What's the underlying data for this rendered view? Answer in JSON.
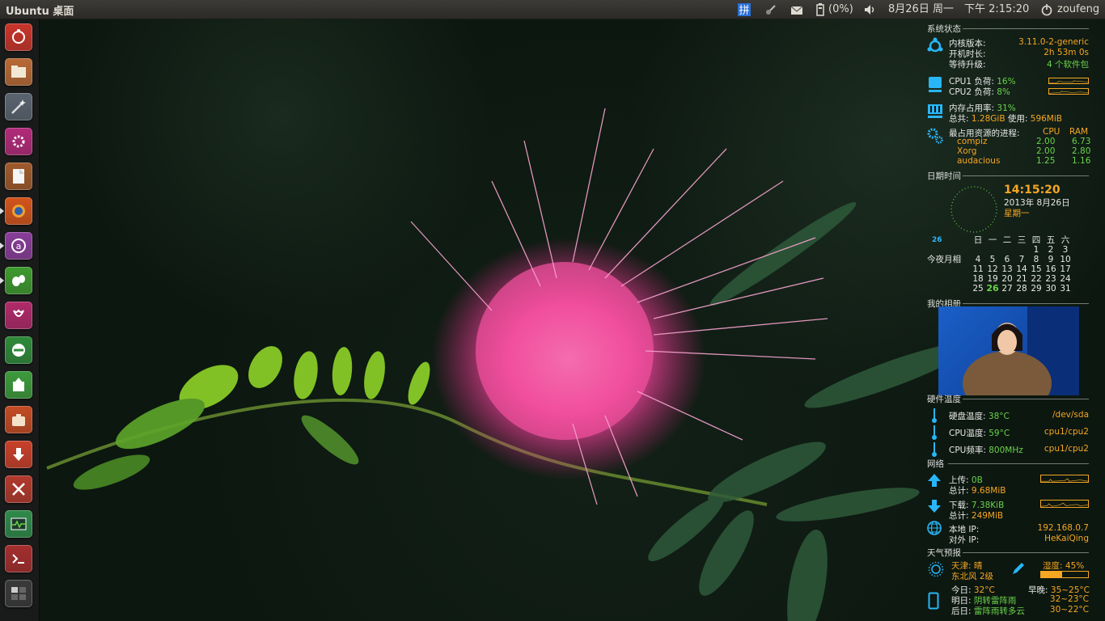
{
  "panel": {
    "title": "Ubuntu 桌面",
    "battery": "(0%)",
    "date": "8月26日 周一",
    "time": "下午 2:15:20",
    "user": "zoufeng"
  },
  "launcher": {
    "items": [
      {
        "name": "dash-home",
        "color": "#c9352b"
      },
      {
        "name": "files",
        "color": "#b86a36"
      },
      {
        "name": "magic-wand",
        "color": "#5a6470"
      },
      {
        "name": "system-settings",
        "color": "#b22a7a"
      },
      {
        "name": "libreoffice",
        "color": "#a05a2c"
      },
      {
        "name": "firefox",
        "color": "#d2541d"
      },
      {
        "name": "app-center",
        "color": "#8a3e99"
      },
      {
        "name": "pidgin",
        "color": "#3f9a2f"
      },
      {
        "name": "tulip",
        "color": "#b02a6a"
      },
      {
        "name": "no-entry",
        "color": "#2f8a3a"
      },
      {
        "name": "update",
        "color": "#3d9a3c"
      },
      {
        "name": "briefcase",
        "color": "#c44b23"
      },
      {
        "name": "download",
        "color": "#c8402a"
      },
      {
        "name": "tools",
        "color": "#b23a2c"
      },
      {
        "name": "system-monitor",
        "color": "#2f8a4a"
      },
      {
        "name": "terminal",
        "color": "#a52e2e"
      },
      {
        "name": "workspace",
        "color": "#3a3a3a"
      }
    ]
  },
  "conky": {
    "system_status": {
      "header": "系统状态",
      "kernel_label": "内核版本:",
      "kernel_value": "3.11.0-2-generic",
      "uptime_label": "开机时长:",
      "uptime_value": "2h 53m 0s",
      "updates_label": "等待升级:",
      "updates_value": "4 个软件包",
      "cpu1_label": "CPU1 负荷:",
      "cpu1_value": "16%",
      "cpu2_label": "CPU2 负荷:",
      "cpu2_value": "8%",
      "mem_label": "内存占用率:",
      "mem_value": "31%",
      "total_label": "总共:",
      "total_value": "1.28GiB",
      "used_label": "使用:",
      "used_value": "596MiB",
      "top_label": "最占用资源的进程:",
      "top_cpu": "CPU",
      "top_ram": "RAM",
      "procs": [
        {
          "name": "compiz",
          "cpu": "2.00",
          "ram": "6.73"
        },
        {
          "name": "Xorg",
          "cpu": "2.00",
          "ram": "2.80"
        },
        {
          "name": "audacious",
          "cpu": "1.25",
          "ram": "1.16"
        }
      ]
    },
    "datetime": {
      "header": "日期时间",
      "clock": "14:15:20",
      "date": "2013年  8月26日",
      "weekday": "星期一",
      "moon_day": "26",
      "moon_label": "今夜月相",
      "weekdays": [
        "日",
        "一",
        "二",
        "三",
        "四",
        "五",
        "六"
      ],
      "weeks": [
        [
          "",
          "",
          "",
          "",
          "1",
          "2",
          "3"
        ],
        [
          "4",
          "5",
          "6",
          "7",
          "8",
          "9",
          "10"
        ],
        [
          "11",
          "12",
          "13",
          "14",
          "15",
          "16",
          "17"
        ],
        [
          "18",
          "19",
          "20",
          "21",
          "22",
          "23",
          "24"
        ],
        [
          "25",
          "26",
          "27",
          "28",
          "29",
          "30",
          "31"
        ]
      ],
      "today": "26"
    },
    "album": {
      "header": "我的相册"
    },
    "hardware": {
      "header": "硬件温度",
      "disk_label": "硬盘温度:",
      "disk_value": "38°C",
      "disk_dev": "/dev/sda",
      "cpu_label": "CPU温度:",
      "cpu_value": "59°C",
      "cpu_dev": "cpu1/cpu2",
      "freq_label": "CPU频率:",
      "freq_value": "800MHz",
      "freq_dev": "cpu1/cpu2"
    },
    "network": {
      "header": "网络",
      "up_label": "上传:",
      "up_value": "0B",
      "up_total_label": "总计:",
      "up_total_value": "9.68MiB",
      "down_label": "下载:",
      "down_value": "7.38KiB",
      "down_total_label": "总计:",
      "down_total_value": "249MiB",
      "local_label": "本地 IP:",
      "local_value": "192.168.0.7",
      "public_label": "对外 IP:",
      "public_value": "HeKaiQing"
    },
    "weather": {
      "header": "天气预报",
      "city": "天津: 晴",
      "wind": "东北风 2级",
      "humidity_label": "湿度:",
      "humidity_value": "45%",
      "humidity_level": 0.45,
      "today_label": "今日:",
      "today_value": "32°C",
      "range_label": "早晚:",
      "range_value": "35~25°C",
      "tomorrow_label": "明日:",
      "tomorrow_value": "阴转雷阵雨",
      "tomorrow_range": "32~23°C",
      "after_label": "后日:",
      "after_value": "雷阵雨转多云",
      "after_range": "30~22°C"
    }
  },
  "colors": {
    "accent_blue": "#29b6f6",
    "green": "#6bd34a",
    "orange": "#f5a623"
  }
}
